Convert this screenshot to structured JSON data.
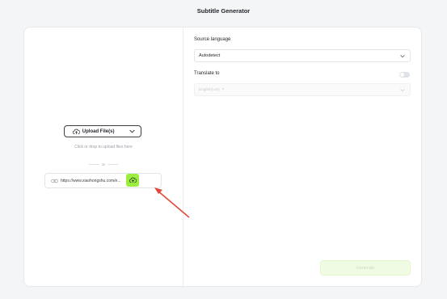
{
  "header": {
    "title": "Subtitle Generator"
  },
  "left_panel": {
    "upload_button": {
      "label": "Upload File(s)",
      "icon": "upload-cloud-icon",
      "caret_icon": "chevron-down-icon"
    },
    "hint": "Click or drop to upload files here",
    "or_label": "or",
    "url_input": {
      "value": "https://www.xiaohongshu.com/e...",
      "icon": "link-icon"
    },
    "url_upload_button": {
      "icon": "upload-cloud-icon",
      "color": "#9cee3e"
    },
    "annotation_arrow": {
      "color": "#e0483a"
    }
  },
  "right_panel": {
    "source_language": {
      "label": "Source language",
      "value": "Autodetect"
    },
    "translate_to": {
      "label": "Translate to",
      "toggle_on": false,
      "selected_chip": "English(US)"
    },
    "generate_button": {
      "label": "Generate",
      "enabled": false
    }
  },
  "colors": {
    "accent": "#9cee3e",
    "background": "#f4f5f7",
    "card": "#ffffff"
  }
}
